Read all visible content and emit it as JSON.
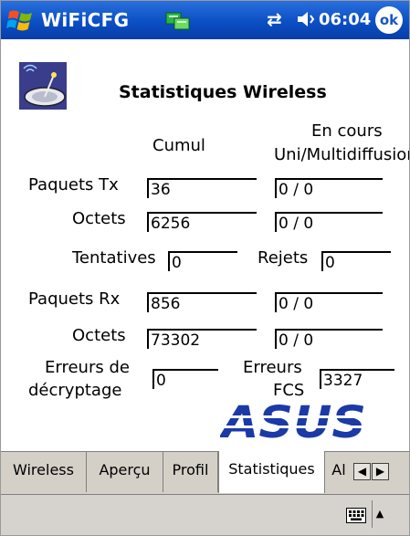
{
  "titlebar": {
    "app_title": "WiFiCFG",
    "clock": "06:04",
    "ok_label": "ok",
    "sync_glyph": "⇄"
  },
  "content": {
    "heading": "Statistiques Wireless",
    "col_cumul": "Cumul",
    "col_current_1": "En cours",
    "col_current_2": "Uni/Multidiffusion",
    "tx_label": "Paquets Tx",
    "tx_cumul": "36",
    "tx_current": "0 / 0",
    "tx_bytes_label": "Octets",
    "tx_bytes_cumul": "6256",
    "tx_bytes_current": "0 / 0",
    "attempts_label": "Tentatives",
    "attempts_value": "0",
    "rejects_label": "Rejets",
    "rejects_value": "0",
    "rx_label": "Paquets Rx",
    "rx_cumul": "856",
    "rx_current": "0 / 0",
    "rx_bytes_label": "Octets",
    "rx_bytes_cumul": "73302",
    "rx_bytes_current": "0 / 0",
    "decrypt_label_1": "Erreurs de",
    "decrypt_label_2": "décryptage",
    "decrypt_value": "0",
    "fcs_label_1": "Erreurs",
    "fcs_label_2": "FCS",
    "fcs_value": "3327",
    "brand_logo": "ASUS"
  },
  "tabs": [
    {
      "label": "Wireless",
      "active": false
    },
    {
      "label": "Aperçu",
      "active": false
    },
    {
      "label": "Profil",
      "active": false
    },
    {
      "label": "Statistiques",
      "active": true
    },
    {
      "label": "Al",
      "active": false
    }
  ],
  "icons": {
    "start": "windows-flag-icon",
    "network": "network-status-icon",
    "sync": "sync-arrows-icon",
    "volume": "speaker-icon",
    "header": "wireless-dish-icon",
    "scroll_left": "tab-scroll-left-icon",
    "scroll_right": "tab-scroll-right-icon",
    "keyboard": "keyboard-icon",
    "sip": "sip-arrow-icon"
  },
  "colors": {
    "titlebar": "#0b4fc4",
    "asus_blue": "#1b3aa8",
    "chrome_gray": "#d4d0c8"
  }
}
